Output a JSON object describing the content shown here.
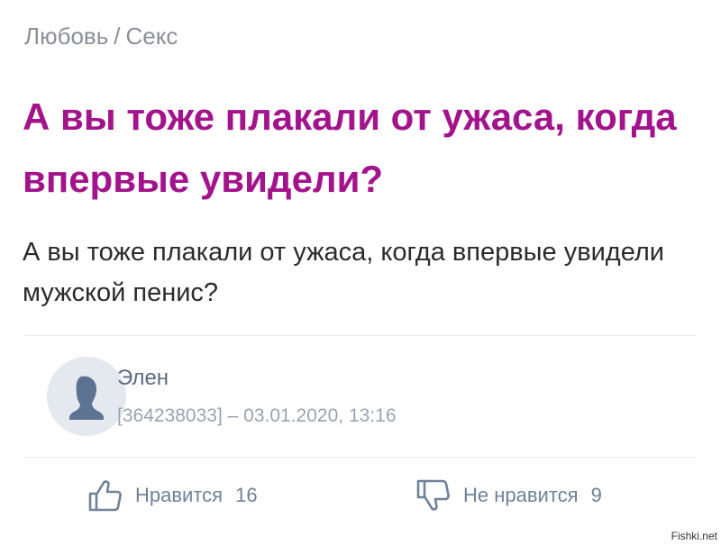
{
  "breadcrumb": {
    "category": "Любовь",
    "separator": "/",
    "subcategory": "Секс"
  },
  "post": {
    "title": "А вы тоже плакали от ужаса, когда впервые увидели?",
    "body": "А вы тоже плакали от ужаса, когда впервые увидели мужской пенис?"
  },
  "author": {
    "name": "Элен",
    "id": "[364238033]",
    "dash": "–",
    "datetime": "03.01.2020, 13:16",
    "avatar_icon": "user-silhouette-icon"
  },
  "actions": {
    "like_label": "Нравится",
    "like_count": "16",
    "like_icon": "thumbs-up-icon",
    "dislike_label": "Не нравится",
    "dislike_count": "9",
    "dislike_icon": "thumbs-down-icon"
  },
  "watermark": "Fishki.net",
  "colors": {
    "title": "#a3148c",
    "meta": "#9aa3b0",
    "action": "#6f8299"
  }
}
